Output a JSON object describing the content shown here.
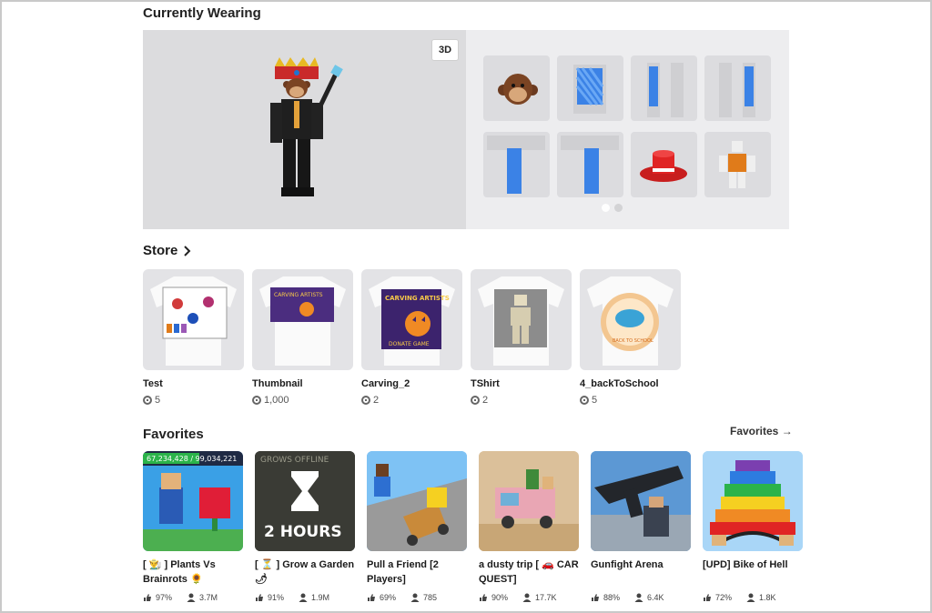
{
  "currently_wearing": {
    "title": "Currently Wearing",
    "view_toggle_label": "3D"
  },
  "store": {
    "title": "Store",
    "items": [
      {
        "name": "Test",
        "price": "5"
      },
      {
        "name": "Thumbnail",
        "price": "1,000"
      },
      {
        "name": "Carving_2",
        "price": "2"
      },
      {
        "name": "TShirt",
        "price": "2"
      },
      {
        "name": "4_backToSchool",
        "price": "5"
      }
    ]
  },
  "favorites": {
    "title": "Favorites",
    "see_all_label": "Favorites →",
    "games": [
      {
        "title": "[ 👨‍🌾 ] Plants Vs Brainrots 🌻",
        "rating": "97%",
        "players": "3.7M",
        "banner": "67,234,428 / 99,034,221"
      },
      {
        "title": "[ ⏳ ] Grow a Garden 🌶",
        "rating": "91%",
        "players": "1.9M",
        "banner": "GROWS OFFLINE",
        "overlay": "2 HOURS"
      },
      {
        "title": "Pull a Friend [2 Players]",
        "rating": "69%",
        "players": "785"
      },
      {
        "title": "a dusty trip [ 🚗 CAR QUEST]",
        "rating": "90%",
        "players": "17.7K"
      },
      {
        "title": "Gunfight Arena",
        "rating": "88%",
        "players": "6.4K"
      },
      {
        "title": "[UPD] Bike of Hell",
        "rating": "72%",
        "players": "1.8K"
      }
    ]
  },
  "shirt_texts": {
    "carving": "CARVING ARTISTS",
    "donate": "DONATE GAME",
    "school": "BACK TO SCHOOL"
  },
  "colors": {
    "panel_dark": "#dcdcde",
    "panel_light": "#ededef",
    "tile": "#dcdcdf"
  }
}
